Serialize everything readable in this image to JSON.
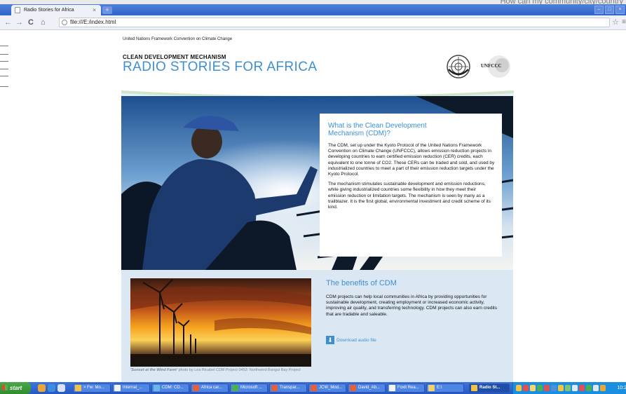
{
  "background_window": {
    "ghost_text": "How can my community/city/country"
  },
  "browser": {
    "tab_title": "Radio Stories for Africa",
    "tab_close": "×",
    "new_tab": "+",
    "nav": {
      "back": "←",
      "forward": "→",
      "reload": "C",
      "home": "⌂"
    },
    "url": "file:///E:/index.html",
    "bookmark_star": "☆",
    "menu": "≡",
    "window_buttons": [
      "–",
      "□",
      "×"
    ]
  },
  "page": {
    "header": {
      "org_line": "United Nations Framework Convention on Climate Change",
      "kicker": "CLEAN DEVELOPMENT MECHANISM",
      "title": "RADIO STORIES FOR AFRICA",
      "unfccc_logo_text": "UNFCCC"
    },
    "infobox": {
      "title": "What is the Clean Development Mechanism (CDM)?",
      "p1": "The CDM, set up under the Kyoto Protocol of the United Nations Framework Convention on Climate Change (UNFCCC), allows emission reduction projects in developing countries to earn certified emission reduction (CER) credits, each equivalent to one tonne of CO2. These CERs can be traded and sold, and used by industrialized countries to meet a part of their emission reduction targets under the Kyoto Protocol.",
      "p2": "The mechanism stimulates sustainable development and emission reductions, while giving industrialized countries some flexibility in how they meet their emission reduction or limitation targets. The mechanism is seen by many as a trailblazer. It is the first global, environmental investment and credit scheme of its kind."
    },
    "benefits": {
      "title": "The benefits of CDM",
      "text": "CDM projects can help local communities in Africa by providing opportunities for sustainable development, creating employment or increased economic activity, improving air quality, and transferring technology. CDM projects can also earn credits that are tradable and saleable.",
      "download_label": "Download audio file"
    },
    "photo_caption": {
      "title": "'Sunset at the Wind Farm'",
      "text": " photo by Lea Ricabel CDM Project 0453: Northwind Bangui Bay Project"
    }
  },
  "taskbar": {
    "start_label": "start",
    "buttons": [
      {
        "label": "> Fw: Mo..."
      },
      {
        "label": "Internal_..."
      },
      {
        "label": "CDM: CD..."
      },
      {
        "label": "Africa car..."
      },
      {
        "label": "Microsoft ..."
      },
      {
        "label": "Transpar..."
      },
      {
        "label": "JCW_Mod..."
      },
      {
        "label": "David_Ab..."
      },
      {
        "label": "Foxit Rea..."
      },
      {
        "label": "E:\\"
      },
      {
        "label": "Radio St..."
      }
    ],
    "clock": "10:2"
  }
}
